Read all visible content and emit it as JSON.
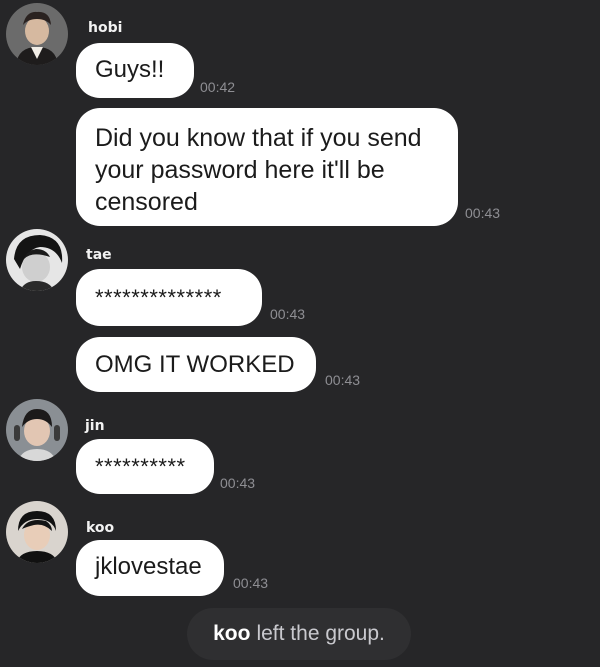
{
  "messages": [
    {
      "sender": "hobi",
      "text": "Guys!!",
      "time": "00:42"
    },
    {
      "sender": "hobi",
      "text": "Did you know that if you send your password here it'll be censored",
      "time": "00:43"
    },
    {
      "sender": "tae",
      "text": "**************",
      "time": "00:43"
    },
    {
      "sender": "tae",
      "text": "OMG IT WORKED",
      "time": "00:43"
    },
    {
      "sender": "jin",
      "text": "**********",
      "time": "00:43"
    },
    {
      "sender": "koo",
      "text": "jklovestae",
      "time": "00:43"
    }
  ],
  "system_notice": {
    "user": "koo",
    "text": "left the group."
  },
  "colors": {
    "background": "#262628",
    "bubble": "#ffffff",
    "timestamp": "#8e8e93"
  },
  "icons": [
    "avatar-hobi",
    "avatar-tae",
    "avatar-jin",
    "avatar-koo"
  ]
}
